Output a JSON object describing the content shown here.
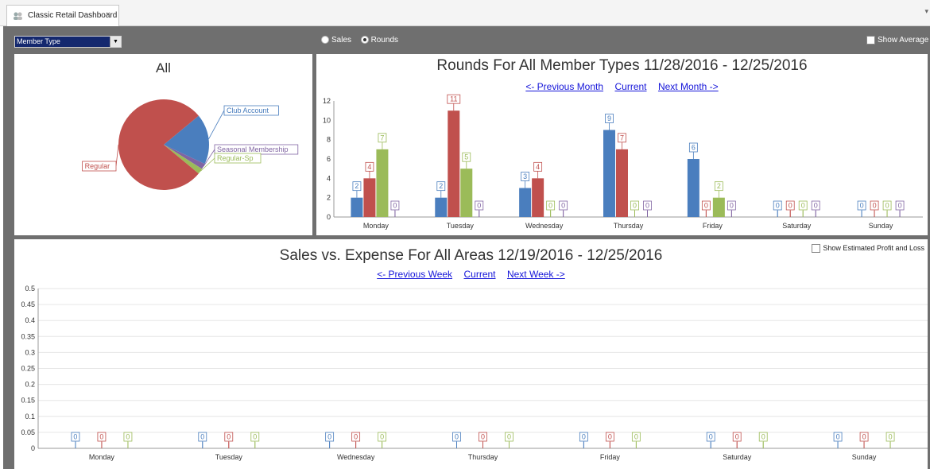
{
  "tab": {
    "label": "Classic Retail Dashboard",
    "close": "×",
    "menu": "▾"
  },
  "controls": {
    "member_type": "Member Type",
    "sales_label": "Sales",
    "rounds_label": "Rounds",
    "selected": "Rounds",
    "show_average": "Show Average"
  },
  "pie": {
    "title": "All"
  },
  "rounds": {
    "title": "Rounds For All Member Types 11/28/2016 - 12/25/2016",
    "prev": "<- Previous Month",
    "current": "Current",
    "next": "Next Month ->"
  },
  "sales": {
    "title": "Sales vs. Expense For All Areas 12/19/2016 - 12/25/2016",
    "prev": "<- Previous Week",
    "current": "Current",
    "next": "Next Week ->",
    "show_profit": "Show Estimated Profit and Loss"
  },
  "colors": {
    "blue": "#4a7ebe",
    "red": "#c0504d",
    "green": "#9bbb59",
    "purple": "#8064a2"
  },
  "chart_data": [
    {
      "type": "pie",
      "title": "All",
      "slices": [
        {
          "label": "Club Account",
          "value": 18,
          "color": "#4a7ebe"
        },
        {
          "label": "Seasonal Membership",
          "value": 2,
          "color": "#8064a2"
        },
        {
          "label": "Regular-Sp",
          "value": 2,
          "color": "#9bbb59"
        },
        {
          "label": "Regular",
          "value": 78,
          "color": "#c0504d"
        }
      ]
    },
    {
      "type": "bar",
      "title": "Rounds For All Member Types 11/28/2016 - 12/25/2016",
      "categories": [
        "Monday",
        "Tuesday",
        "Wednesday",
        "Thursday",
        "Friday",
        "Saturday",
        "Sunday"
      ],
      "ylim": [
        0,
        12
      ],
      "yticks": [
        0,
        2,
        4,
        6,
        8,
        10,
        12
      ],
      "series": [
        {
          "color": "#4a7ebe",
          "values": [
            2,
            2,
            3,
            9,
            6,
            0,
            0
          ]
        },
        {
          "color": "#c0504d",
          "values": [
            4,
            11,
            4,
            7,
            0,
            0,
            0
          ]
        },
        {
          "color": "#9bbb59",
          "values": [
            7,
            5,
            0,
            0,
            2,
            0,
            0
          ]
        },
        {
          "color": "#8064a2",
          "values": [
            0,
            0,
            0,
            0,
            0,
            0,
            0
          ]
        }
      ]
    },
    {
      "type": "bar",
      "title": "Sales vs. Expense For All Areas 12/19/2016 - 12/25/2016",
      "categories": [
        "Monday",
        "Tuesday",
        "Wednesday",
        "Thursday",
        "Friday",
        "Saturday",
        "Sunday"
      ],
      "ylim": [
        0,
        0.5
      ],
      "yticks": [
        "0",
        "0.05",
        "0.1",
        "0.15",
        "0.2",
        "0.25",
        "0.3",
        "0.35",
        "0.4",
        "0.45",
        "0.5"
      ],
      "series": [
        {
          "color": "#4a7ebe",
          "values": [
            0,
            0,
            0,
            0,
            0,
            0,
            0
          ]
        },
        {
          "color": "#c0504d",
          "values": [
            0,
            0,
            0,
            0,
            0,
            0,
            0
          ]
        },
        {
          "color": "#9bbb59",
          "values": [
            0,
            0,
            0,
            0,
            0,
            0,
            0
          ]
        }
      ]
    }
  ]
}
